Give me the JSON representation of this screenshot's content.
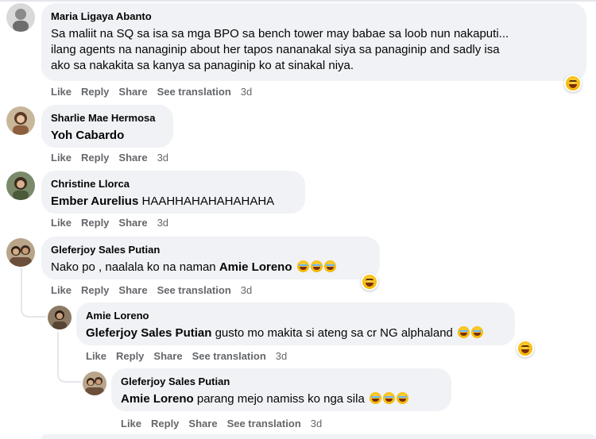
{
  "action_labels": {
    "like": "Like",
    "reply": "Reply",
    "share": "Share",
    "see_translation": "See translation"
  },
  "comments": [
    {
      "author": "Maria Ligaya Abanto",
      "lines": [
        "Sa maliit na SQ sa isa sa mga BPO sa bench tower may babae sa loob nun nakaputi...",
        "ilang agents na nanaginip about her tapos nananakal siya sa panaginip and sadly isa",
        "ako sa nakakita sa kanya sa panaginip ko at sinakal niya."
      ],
      "time": "3d",
      "reaction": "haha-icon"
    },
    {
      "author": "Sharlie Mae Hermosa",
      "mention": "Yoh Cabardo",
      "rest": "",
      "time": "3d"
    },
    {
      "author": "Christine Llorca",
      "mention": "Ember Aurelius",
      "rest": " HAAHHAHAHAHAHAHA",
      "time": "3d"
    },
    {
      "author": "Gleferjoy Sales Putian",
      "prefix": "Nako po , naalala ko na naman ",
      "mention": "Amie Loreno",
      "time": "3d",
      "reaction": "haha-icon"
    },
    {
      "author": "Amie Loreno",
      "mention": "Gleferjoy Sales Putian",
      "rest": " gusto mo makita si ateng sa cr NG alphaland",
      "time": "3d",
      "reaction": "haha-icon"
    },
    {
      "author": "Gleferjoy Sales Putian",
      "mention": "Amie Loreno",
      "rest": " parang mejo namiss ko nga sila",
      "time": "3d"
    }
  ]
}
